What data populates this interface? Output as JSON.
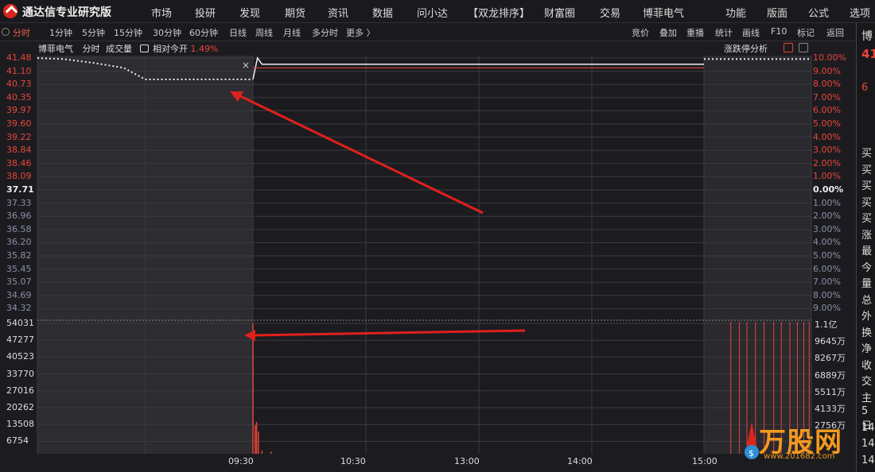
{
  "app": {
    "title": "通达信专业研究版"
  },
  "menu": [
    "市场",
    "投研",
    "发现",
    "期货",
    "资讯",
    "数据",
    "问小达",
    "【双龙排序】",
    "财富圈",
    "交易",
    "博菲电气"
  ],
  "right_menu": [
    "功能",
    "版面",
    "公式",
    "选项"
  ],
  "period_tabs": [
    "分时",
    "1分钟",
    "5分钟",
    "15分钟",
    "30分钟",
    "60分钟",
    "日线",
    "周线",
    "月线",
    "多分时",
    "更多 〉"
  ],
  "tools": [
    "竞价",
    "叠加",
    "重播",
    "统计",
    "画线",
    "F10",
    "标记",
    "返回"
  ],
  "chart_header": {
    "stock_name": "博菲电气",
    "mode": "分时",
    "volume_label": "成交量",
    "relative_label": "相对今开",
    "relative_value": "1.49%",
    "close_mark": "×"
  },
  "limit_analysis": "涨跌停分析",
  "colors": {
    "up": "#e8453a",
    "neutral": "#eeeeee",
    "down": "#8a8fa5",
    "arrow": "#e0201c",
    "accent": "#e85c4a"
  },
  "chart_data": {
    "type": "line",
    "x_ticks": [
      "09:30",
      "10:30",
      "13:00",
      "14:00",
      "15:00"
    ],
    "price_axis": [
      "41.48",
      "41.10",
      "40.73",
      "40.35",
      "39.97",
      "39.60",
      "39.22",
      "38.84",
      "38.46",
      "38.09",
      "37.71",
      "37.33",
      "36.96",
      "36.58",
      "36.20",
      "35.82",
      "35.45",
      "35.07",
      "34.69",
      "34.32"
    ],
    "pct_axis": [
      "10.00%",
      "9.00%",
      "8.00%",
      "7.00%",
      "6.00%",
      "5.00%",
      "4.00%",
      "3.00%",
      "2.00%",
      "1.00%",
      "0.00%",
      "1.00%",
      "2.00%",
      "3.00%",
      "4.00%",
      "5.00%",
      "6.00%",
      "7.00%",
      "8.00%",
      "9.00%"
    ],
    "prev_close": 37.71,
    "ylim": [
      34.32,
      41.48
    ],
    "auction_price": [
      {
        "t": 0.0,
        "p": 41.48
      },
      {
        "t": 0.12,
        "p": 41.45
      },
      {
        "t": 0.25,
        "p": 41.35
      },
      {
        "t": 0.4,
        "p": 41.2
      },
      {
        "t": 0.5,
        "p": 40.87
      },
      {
        "t": 0.7,
        "p": 40.87
      },
      {
        "t": 1.0,
        "p": 40.87
      }
    ],
    "session_price": [
      {
        "t": 0.0,
        "p": 40.87
      },
      {
        "t": 0.01,
        "p": 41.48
      },
      {
        "t": 0.02,
        "p": 41.3
      },
      {
        "t": 0.2,
        "p": 41.3
      },
      {
        "t": 1.0,
        "p": 41.3
      }
    ],
    "volume_axis": [
      "54031",
      "47277",
      "40523",
      "33770",
      "27016",
      "20262",
      "13508",
      "6754"
    ],
    "amount_axis": [
      "1.1亿",
      "9645万",
      "8267万",
      "6889万",
      "5511万",
      "4133万",
      "2756万"
    ],
    "vol_max": 54031,
    "session_volume": [
      {
        "t": 0.0,
        "v": 54031
      },
      {
        "t": 0.005,
        "v": 11800
      },
      {
        "t": 0.008,
        "v": 13200
      },
      {
        "t": 0.012,
        "v": 9200
      },
      {
        "t": 0.02,
        "v": 1300
      },
      {
        "t": 0.04,
        "v": 900
      }
    ],
    "closing_volume": [
      0.25,
      0.33,
      0.4,
      0.48,
      0.56,
      0.65,
      0.72,
      0.8,
      0.87,
      0.93,
      0.98
    ]
  },
  "right_panel": {
    "header": "博",
    "price": "41",
    "extra": "6",
    "labels": [
      "买",
      "买",
      "买",
      "买",
      "买",
      "涨",
      "最",
      "今",
      "量",
      "总",
      "外",
      "换",
      "净",
      "收",
      "交",
      "主",
      "5日",
      "14",
      "14",
      "14"
    ]
  },
  "watermark": {
    "brand": "万股网",
    "url": "www.201682.com"
  }
}
